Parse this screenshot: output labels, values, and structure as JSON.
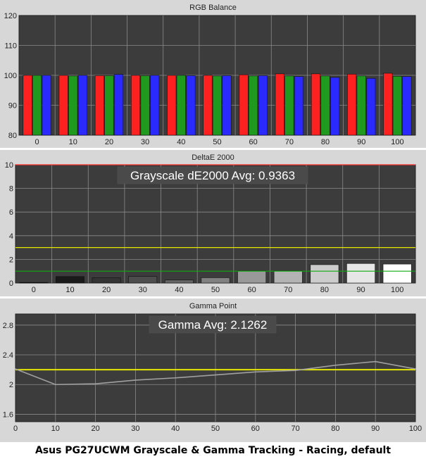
{
  "caption": "Asus PG27UCWM Grayscale & Gamma Tracking - Racing, default",
  "colors": {
    "red": "#ff2020",
    "green": "#1f9a1f",
    "blue": "#2a2aff",
    "panel_bg": "#3c3c3c",
    "frame_bg": "#d7d7d7",
    "reference_yellow": "#e6e600",
    "reference_green": "#11aa11",
    "reference_red": "#ff3030"
  },
  "chart_data": [
    {
      "type": "bar",
      "title": "RGB Balance",
      "categories": [
        "0",
        "10",
        "20",
        "30",
        "40",
        "50",
        "60",
        "70",
        "80",
        "90",
        "100"
      ],
      "series": [
        {
          "name": "Red",
          "values": [
            100.0,
            100.0,
            99.9,
            100.0,
            100.0,
            100.0,
            100.2,
            100.5,
            100.5,
            100.4,
            100.7
          ]
        },
        {
          "name": "Green",
          "values": [
            100.0,
            99.8,
            99.9,
            99.9,
            100.0,
            99.8,
            99.8,
            99.8,
            99.8,
            99.8,
            99.7
          ]
        },
        {
          "name": "Blue",
          "values": [
            100.0,
            100.0,
            100.3,
            100.0,
            99.9,
            99.9,
            99.9,
            99.6,
            99.3,
            99.0,
            99.6
          ]
        }
      ],
      "yticks": [
        "120",
        "110",
        "100",
        "90",
        "80"
      ],
      "ylim": [
        80,
        120
      ]
    },
    {
      "type": "bar",
      "title": "DeltaE 2000",
      "annotation": "Grayscale dE2000 Avg: 0.9363",
      "categories": [
        "0",
        "10",
        "20",
        "30",
        "40",
        "50",
        "60",
        "70",
        "80",
        "90",
        "100"
      ],
      "values": [
        0.05,
        0.55,
        0.45,
        0.55,
        0.25,
        0.45,
        1.05,
        1.05,
        1.55,
        1.65,
        1.6
      ],
      "bar_colors": [
        "#0a0a0a",
        "#1a1a1a",
        "#333333",
        "#4d4d4d",
        "#666666",
        "#808080",
        "#999999",
        "#b3b3b3",
        "#cccccc",
        "#e6e6e6",
        "#ffffff"
      ],
      "reference_lines": [
        10,
        3,
        1
      ],
      "yticks": [
        "10",
        "8",
        "6",
        "4",
        "2",
        "0"
      ],
      "ylim": [
        0,
        10
      ]
    },
    {
      "type": "line",
      "title": "Gamma Point",
      "annotation": "Gamma Avg: 2.1262",
      "x": [
        0,
        10,
        20,
        30,
        40,
        50,
        60,
        70,
        80,
        90,
        100
      ],
      "xticks": [
        "0",
        "10",
        "20",
        "30",
        "40",
        "50",
        "60",
        "70",
        "80",
        "90",
        "100"
      ],
      "values": [
        2.21,
        2.0,
        2.01,
        2.06,
        2.09,
        2.13,
        2.17,
        2.19,
        2.26,
        2.31,
        2.21
      ],
      "reference_line": 2.2,
      "yticks": [
        "2.8",
        "2.4",
        "2",
        "1.6"
      ],
      "ylim": [
        1.5,
        2.95
      ],
      "xlim": [
        0,
        100
      ]
    }
  ]
}
